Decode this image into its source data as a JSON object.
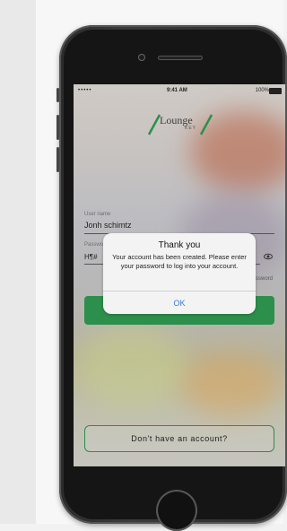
{
  "status_bar": {
    "signal": "••••• ",
    "time": "9:41 AM",
    "battery": "100%"
  },
  "logo": {
    "name": "Lounge",
    "sub": "KEY"
  },
  "form": {
    "username_label": "User name",
    "username_value": "Jonh schimtz",
    "password_label": "Password",
    "password_value": "H¶#",
    "forgot_label": "ssword"
  },
  "alert": {
    "title": "Thank you",
    "message": "Your account has been created. Please enter your password to log into your account.",
    "ok_label": "OK"
  },
  "signup": {
    "label": "Don't have an account?"
  },
  "colors": {
    "accent_green": "#2c8f4b",
    "ios_blue": "#2f7be0"
  }
}
